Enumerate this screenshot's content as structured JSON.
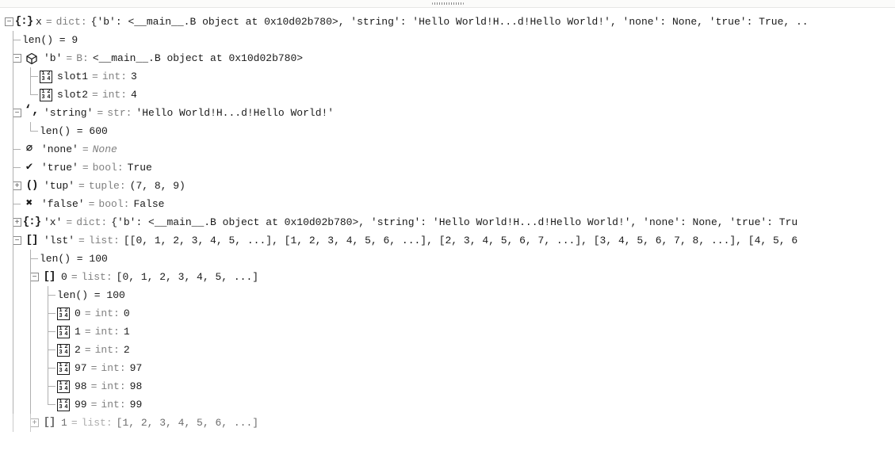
{
  "root": {
    "var": "x",
    "type": "dict:",
    "value": "{'b': <__main__.B object at 0x10d02b780>, 'string': 'Hello World!H...d!Hello World!', 'none': None, 'true': True, ..",
    "len": "len() = 9"
  },
  "b": {
    "key": "'b'",
    "type": "B:",
    "value": "<__main__.B object at 0x10d02b780>",
    "slot1_name": "slot1",
    "slot1_type": "int:",
    "slot1_val": "3",
    "slot2_name": "slot2",
    "slot2_type": "int:",
    "slot2_val": "4"
  },
  "str": {
    "key": "'string'",
    "type": "str:",
    "value": "'Hello World!H...d!Hello World!'",
    "len": "len() = 600"
  },
  "none": {
    "key": "'none'",
    "value": "None"
  },
  "true_": {
    "key": "'true'",
    "type": "bool:",
    "value": "True"
  },
  "tup": {
    "key": "'tup'",
    "type": "tuple:",
    "value": "(7, 8, 9)"
  },
  "false_": {
    "key": "'false'",
    "type": "bool:",
    "value": "False"
  },
  "xrec": {
    "key": "'x'",
    "type": "dict:",
    "value": "{'b': <__main__.B object at 0x10d02b780>, 'string': 'Hello World!H...d!Hello World!', 'none': None, 'true': Tru"
  },
  "lst": {
    "key": "'lst'",
    "type": "list:",
    "value": "[[0, 1, 2, 3, 4, 5, ...], [1, 2, 3, 4, 5, 6, ...], [2, 3, 4, 5, 6, 7, ...], [3, 4, 5, 6, 7, 8, ...], [4, 5, 6",
    "len": "len() = 100"
  },
  "lst0": {
    "key": "0",
    "type": "list:",
    "value": "[0, 1, 2, 3, 4, 5, ...]",
    "len": "len() = 100",
    "i0_name": "0",
    "i0_type": "int:",
    "i0_val": "0",
    "i1_name": "1",
    "i1_type": "int:",
    "i1_val": "1",
    "i2_name": "2",
    "i2_type": "int:",
    "i2_val": "2",
    "i97_name": "97",
    "i97_type": "int:",
    "i97_val": "97",
    "i98_name": "98",
    "i98_type": "int:",
    "i98_val": "98",
    "i99_name": "99",
    "i99_type": "int:",
    "i99_val": "99"
  },
  "lst1": {
    "key": "1",
    "type": "list:",
    "value": "[1, 2, 3, 4, 5, 6, ...]"
  }
}
